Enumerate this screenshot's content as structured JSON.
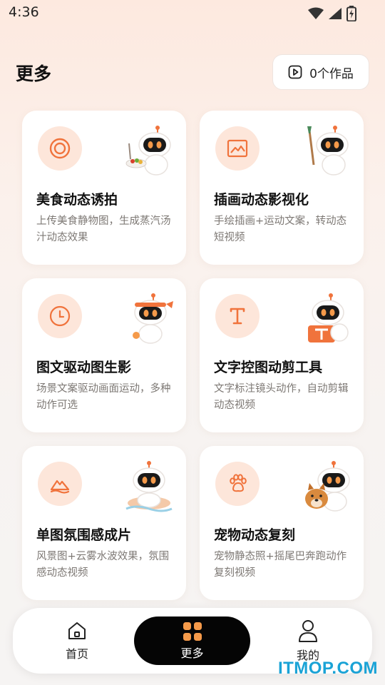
{
  "status_bar": {
    "time": "4:36",
    "icons": [
      "wifi-icon",
      "signal-icon",
      "battery-charging-icon"
    ]
  },
  "header": {
    "title": "更多",
    "works_button": {
      "label": "0个作品",
      "icon": "play-icon"
    }
  },
  "cards": [
    {
      "title": "美食动态诱拍",
      "desc": "上传美食静物图，生成蒸汽汤汁动态效果",
      "icon": "target-icon"
    },
    {
      "title": "插画动态影视化",
      "desc": "手绘插画+运动文案，转动态短视频",
      "icon": "image-icon"
    },
    {
      "title": "图文驱动图生影",
      "desc": "场景文案驱动画面运动，多种动作可选",
      "icon": "clock-icon"
    },
    {
      "title": "文字控图动剪工具",
      "desc": "文字标注镜头动作，自动剪辑动态视频",
      "icon": "text-icon"
    },
    {
      "title": "单图氛围感成片",
      "desc": "风景图+云雾水波效果，氛围感动态视频",
      "icon": "mountain-icon"
    },
    {
      "title": "宠物动态复刻",
      "desc": "宠物静态照+摇尾巴奔跑动作复刻视频",
      "icon": "paw-icon"
    }
  ],
  "bottom_nav": {
    "items": [
      {
        "label": "首页",
        "icon": "home-icon"
      },
      {
        "label": "更多",
        "icon": "grid-icon"
      },
      {
        "label": "我的",
        "icon": "user-icon"
      }
    ],
    "active_index": 1
  },
  "watermark": "ITMOP.COM",
  "colors": {
    "accent": "#f0733c",
    "icon_bg": "#fde6da",
    "active_nav": "#050505"
  }
}
